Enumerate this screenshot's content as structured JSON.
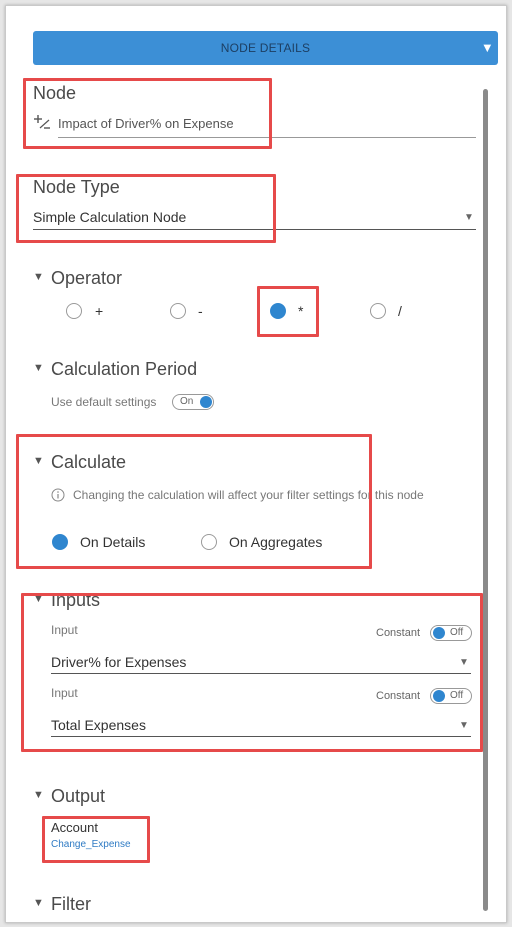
{
  "header": {
    "title": "NODE DETAILS"
  },
  "node": {
    "label": "Node",
    "value": "Impact of Driver% on Expense"
  },
  "node_type": {
    "label": "Node Type",
    "value": "Simple Calculation Node"
  },
  "operator": {
    "label": "Operator",
    "options": [
      "+",
      "-",
      "*",
      "/"
    ],
    "selected": "*"
  },
  "calc_period": {
    "label": "Calculation Period",
    "default_label": "Use default settings",
    "toggle": "On"
  },
  "calculate": {
    "label": "Calculate",
    "info": "Changing the calculation will affect your filter settings for this node",
    "options": [
      "On Details",
      "On Aggregates"
    ],
    "selected": "On Details"
  },
  "inputs": {
    "label": "Inputs",
    "items": [
      {
        "label": "Input",
        "constant_label": "Constant",
        "toggle": "Off",
        "value": "Driver% for Expenses"
      },
      {
        "label": "Input",
        "constant_label": "Constant",
        "toggle": "Off",
        "value": "Total Expenses"
      }
    ]
  },
  "output": {
    "label": "Output",
    "field_label": "Account",
    "value": "Change_Expense"
  },
  "filter": {
    "label": "Filter"
  },
  "colors": {
    "accent": "#2f86cf",
    "header": "#3c8fd6",
    "highlight": "#e64a4a"
  }
}
